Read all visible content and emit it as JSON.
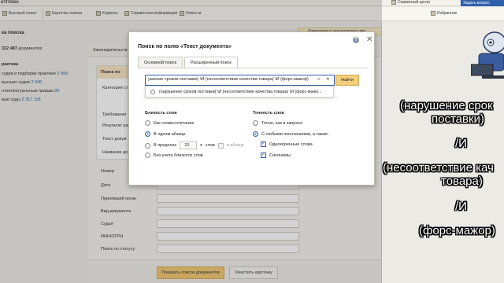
{
  "app": {
    "brand": "нтПлюс",
    "ask_question": "Задать вопрос"
  },
  "toolbar": {
    "items": [
      "Быстрый поиск",
      "Карточка поиска",
      "Кодексы",
      "Справочная информация",
      "Новости"
    ],
    "service_center": "Сервисный центр",
    "favorites": "Избранное"
  },
  "left": {
    "title": "ка поиска",
    "count_num": "322 487",
    "count_label": "документов",
    "section": "рактика",
    "items": [
      {
        "label": "судов и подборки практики",
        "n": "2 999"
      },
      {
        "label": "высших судов",
        "n": "2 345"
      },
      {
        "label": "нтеллектуальным правам",
        "n": "25"
      },
      {
        "label": "вые суды",
        "n": "2 317 118"
      }
    ]
  },
  "form": {
    "tab_label": "Законодательств",
    "notice": "Изменения в законодательстве",
    "panel_header": "Поиск по ",
    "panel_items": [
      "Категория ст",
      "Требования",
      "Результат ра",
      "Текст докум",
      "Название до"
    ],
    "fields": [
      "Номер",
      "Дата",
      "Принявший орган",
      "Вид документа",
      "Судья",
      "ИНН/ОГРН",
      "Поиск по статусу"
    ],
    "find_button": "Показать список документов",
    "clear_button": "Очистить карточку"
  },
  "dialog": {
    "title": "Поиск по полю «Текст документа»",
    "tabs": [
      "Основной поиск",
      "Расширенный поиск"
    ],
    "active_tab": 1,
    "query": "ушение сроков поставки) \\И (несоответствие качества товара) \\И (форс-мажор)",
    "find_button": "Найти",
    "suggestion": "(нарушение сроков поставки) \\И (несоответствие качества товара) \\И (форс-мажо...",
    "proximity": {
      "title": "Близость слов",
      "options": [
        "Как словосочетание",
        "В одном абзаце",
        "В пределах",
        "Без учета близости слов"
      ],
      "selected": 1,
      "within_value": "20",
      "within_unit": "слов",
      "in_paragraph": "в абзаце"
    },
    "accuracy": {
      "title": "Точность слов",
      "options": [
        "Точно, как в запросе",
        "С любыми окончаниями, а также:"
      ],
      "selected": 1,
      "checks": [
        "Однокоренные слова",
        "Синонимы"
      ],
      "checked": [
        true,
        true
      ]
    }
  },
  "caption": {
    "lines": [
      "(нарушение срок",
      "поставки)",
      "/И",
      "(несоответствие кач",
      "товара)",
      "/И",
      "(форс-мажор)"
    ]
  },
  "colors": {
    "accent_blue": "#2f5fa8",
    "button_yellow": "#f4cf7d",
    "panel_header": "#f8e3c0"
  }
}
